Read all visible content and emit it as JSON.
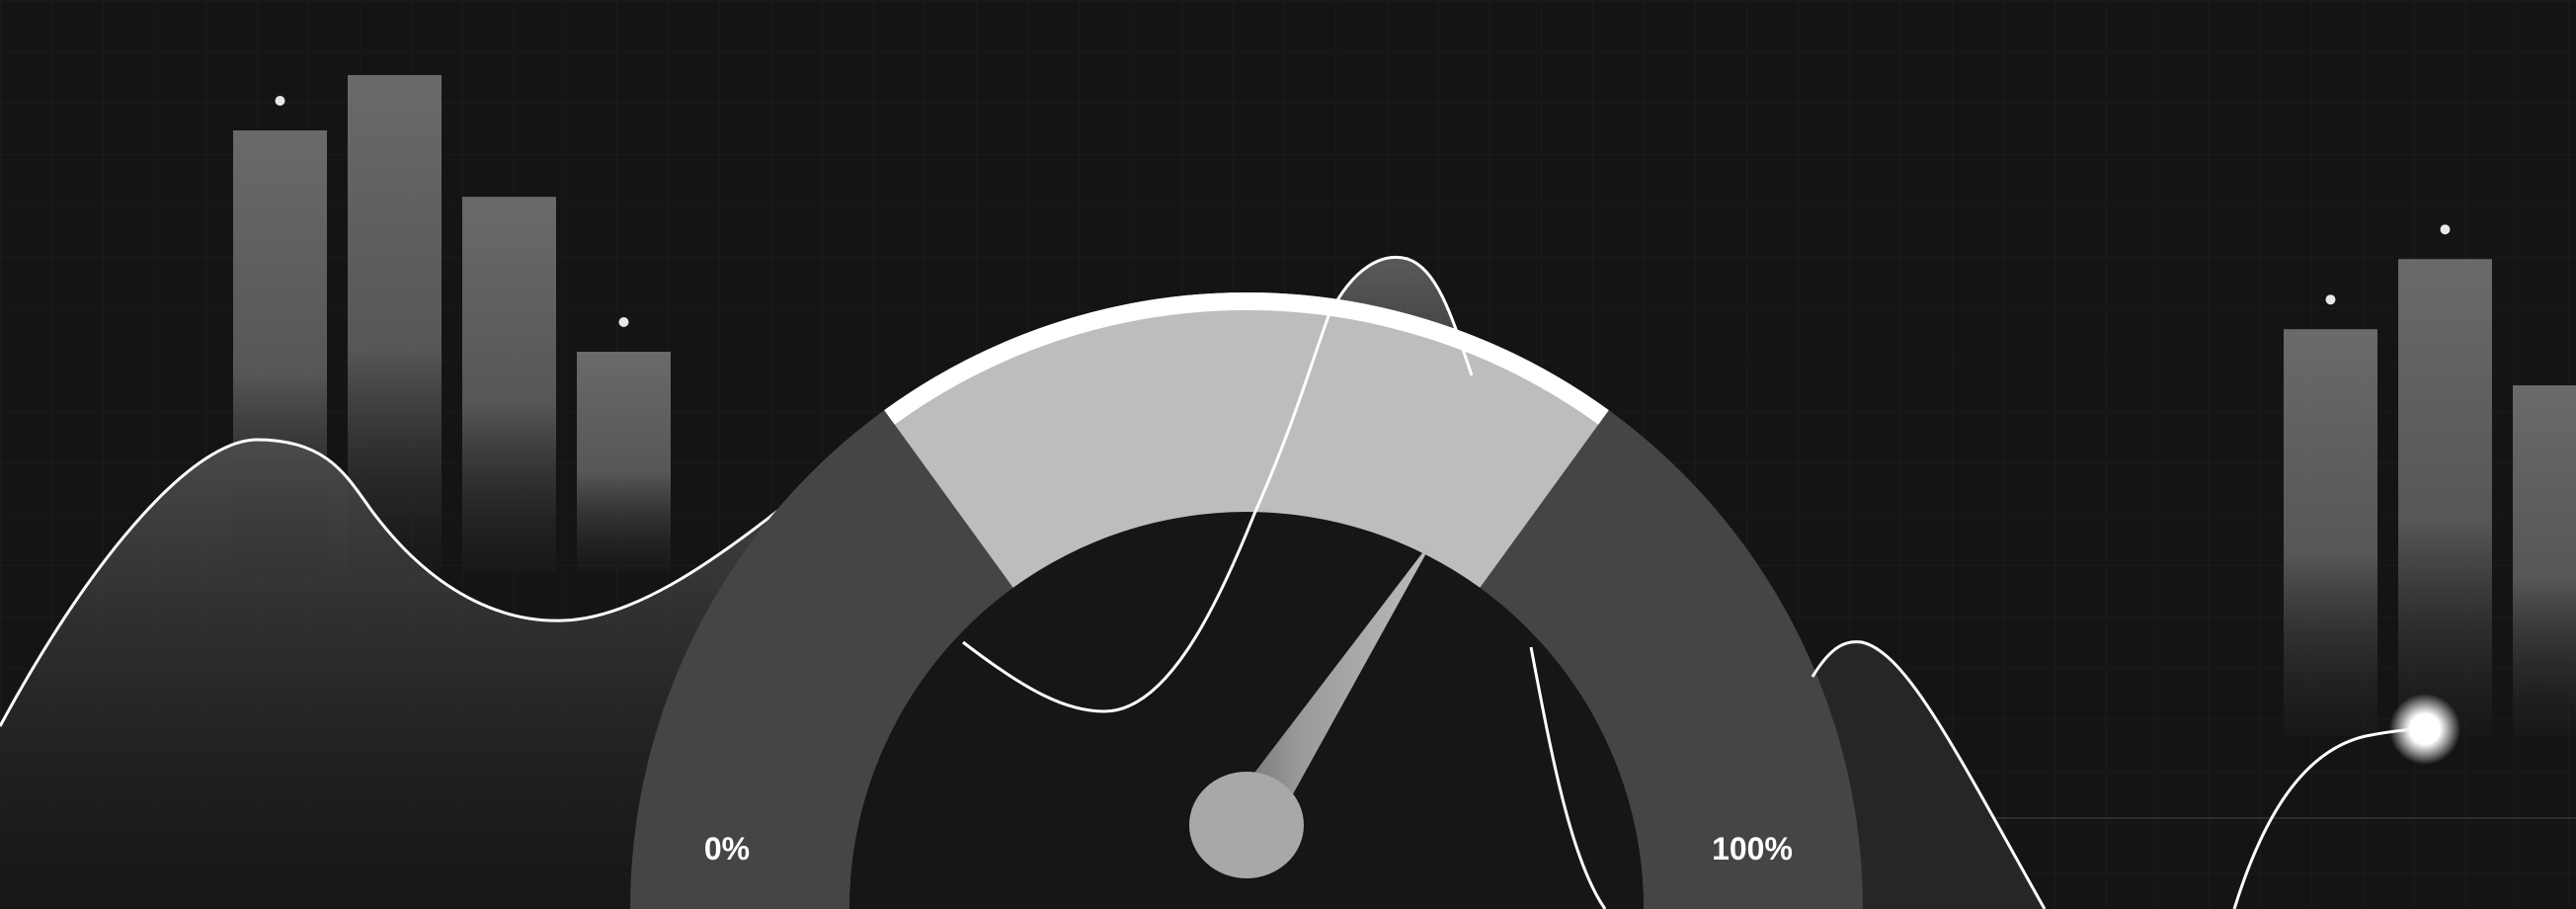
{
  "gauge": {
    "min_label": "0%",
    "max_label": "100%",
    "needle_fraction": 0.66,
    "highlight_band": [
      0.3,
      0.7
    ]
  },
  "colors": {
    "background": "#141414",
    "gauge_ring": "#454545",
    "gauge_highlight": "#bdbdbd",
    "gauge_highlight_edge": "#ffffff",
    "needle": "#a8a8a8",
    "wave_line": "#ffffff",
    "bar": "#6a6a6a",
    "label": "#ffffff"
  },
  "left_bars": {
    "values": [
      0.8,
      0.9,
      0.68,
      0.4
    ],
    "dots": [
      true,
      false,
      false,
      true
    ]
  },
  "right_bars": {
    "values": [
      0.58,
      0.68,
      0.5
    ],
    "dots": [
      true,
      true,
      false
    ]
  }
}
